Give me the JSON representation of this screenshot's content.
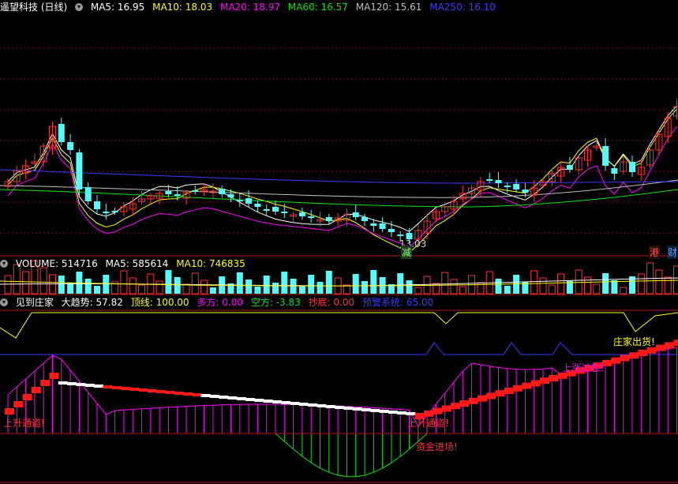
{
  "main_header": {
    "stock": "遥望科技 (日线)",
    "ma5": "MA5: 16.95",
    "ma10": "MA10: 18.03",
    "ma20": "MA20: 18.97",
    "ma60": "MA60: 16.57",
    "ma120": "MA120: 15.61",
    "ma250": "MA250: 16.10"
  },
  "main_annotations": {
    "low_price": "13.03",
    "reduce_tag": "减",
    "hk_tag": "港",
    "fin_tag": "财"
  },
  "volume_header": {
    "volume": "VOLUME: 514716",
    "ma5": "MA5: 585614",
    "ma10": "MA10: 746835"
  },
  "indicator_header": {
    "name": "见到庄家",
    "trend": "大趋势: 57.82",
    "top": "顶线: 100.00",
    "long": "多方: 0.00",
    "short": "空方: -3.83",
    "bottom": "抄底: 0.00",
    "warning": "预警系统: 65.00"
  },
  "indicator_annotations": {
    "up_channel_1": "上升通道!",
    "up_channel_2": "上升通道!",
    "capital_in": "资金进场!",
    "rise_too_fast": "上涨过急!",
    "dealer_out": "庄家出货!"
  },
  "colors": {
    "up": "#ff3232",
    "down": "#54fcfc",
    "ma5": "#ffffff",
    "ma10": "#ffff00",
    "ma20": "#ff00ff",
    "ma60": "#00e600",
    "ma120": "#c0c0c0",
    "ma250": "#3c3cff",
    "grid": "#7a1010"
  }
}
